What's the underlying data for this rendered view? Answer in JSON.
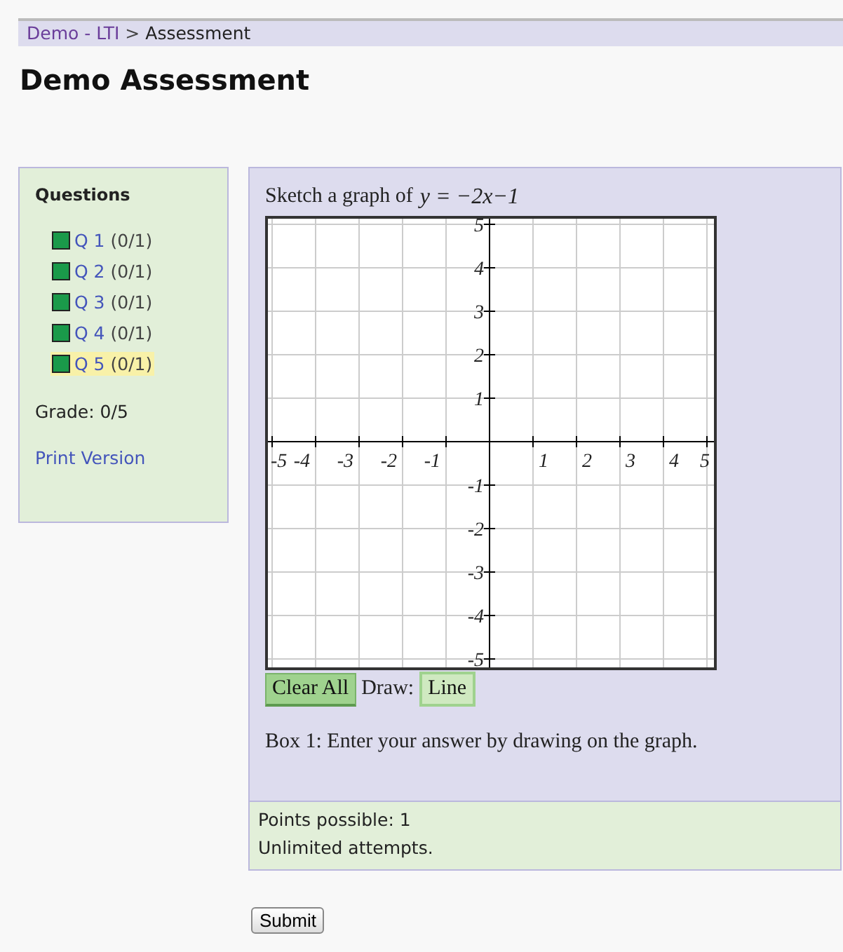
{
  "breadcrumb": {
    "link": "Demo - LTI",
    "separator": ">",
    "current": "Assessment"
  },
  "title": "Demo Assessment",
  "sidebar": {
    "heading": "Questions",
    "questions": [
      {
        "label": "Q 1",
        "score": "(0/1)",
        "selected": false,
        "color": "#1a9a4a"
      },
      {
        "label": "Q 2",
        "score": "(0/1)",
        "selected": false,
        "color": "#1a9a4a"
      },
      {
        "label": "Q 3",
        "score": "(0/1)",
        "selected": false,
        "color": "#1a9a4a"
      },
      {
        "label": "Q 4",
        "score": "(0/1)",
        "selected": false,
        "color": "#1a9a4a"
      },
      {
        "label": "Q 5",
        "score": "(0/1)",
        "selected": true,
        "color": "#1a9a4a"
      }
    ],
    "grade": "Grade: 0/5",
    "print_link": "Print Version"
  },
  "question": {
    "prompt": "Sketch a graph of",
    "formula": "y = −2x−1",
    "graph": {
      "x_ticks": [
        "-5",
        "-4",
        "-3",
        "-2",
        "-1",
        "1",
        "2",
        "3",
        "4",
        "5"
      ],
      "y_ticks": [
        "5",
        "4",
        "3",
        "2",
        "1",
        "-1",
        "-2",
        "-3",
        "-4",
        "-5"
      ]
    },
    "clear_button": "Clear All",
    "draw_label": "Draw:",
    "tools": [
      {
        "label": "Line",
        "selected": true
      }
    ],
    "instruction": "Box 1: Enter your answer by drawing on the graph."
  },
  "info": [
    "Points possible: 1",
    "Unlimited attempts."
  ],
  "submit": "Submit"
}
